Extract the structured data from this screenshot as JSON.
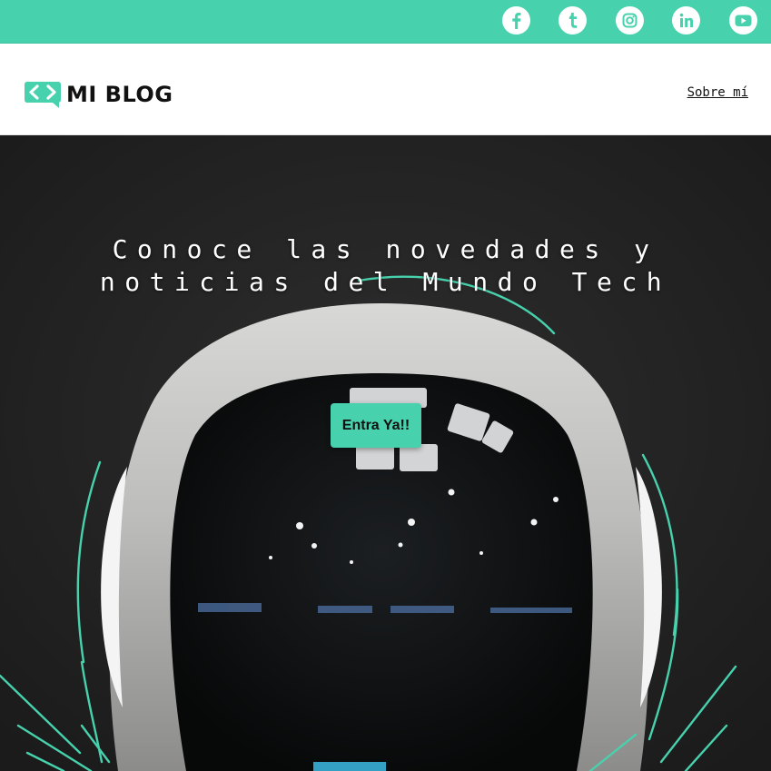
{
  "topbar": {
    "accent_color": "#48d1ad",
    "social_icons": [
      "facebook-icon",
      "tumblr-icon",
      "instagram-icon",
      "linkedin-icon",
      "youtube-icon"
    ]
  },
  "header": {
    "logo_text": "MI BLOG",
    "logo_icon": "code-chat-icon",
    "nav_link": "Sobre mí"
  },
  "hero": {
    "title_line1": "Conoce las novedades y",
    "title_line2": "noticias del Mundo Tech",
    "cta_label": "Entra Ya!!"
  }
}
